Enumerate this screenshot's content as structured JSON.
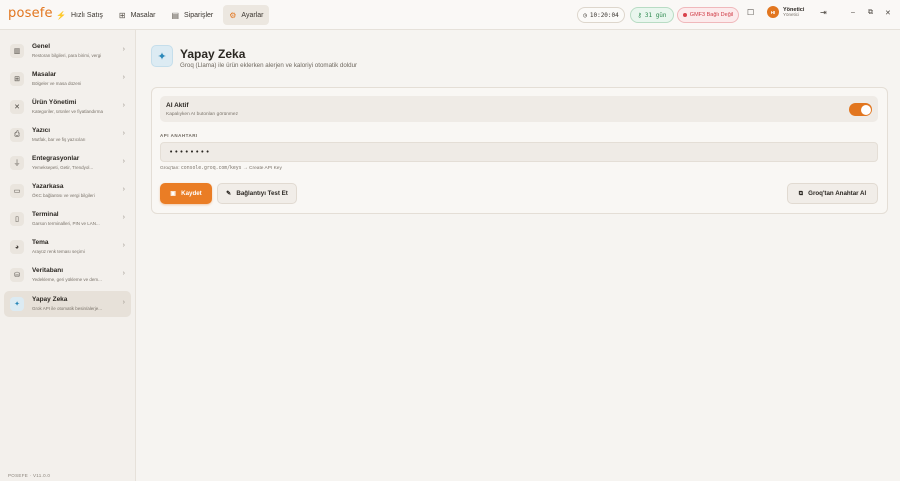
{
  "app": {
    "logo": "posefe",
    "version": "POSEFE · V11.0.0"
  },
  "topbar": {
    "nav": [
      {
        "label": "Hızlı Satış",
        "icon": "bolt-icon"
      },
      {
        "label": "Masalar",
        "icon": "grid-icon"
      },
      {
        "label": "Siparişler",
        "icon": "clipboard-icon"
      },
      {
        "label": "Ayarlar",
        "icon": "gear-icon"
      }
    ],
    "clock": "10:20:04",
    "days": "31 gün",
    "gmf_status": "GMF3 Bağlı Değil",
    "user": {
      "initials": "HI",
      "name": "Yönetici",
      "role": "Yönetici"
    }
  },
  "sidebar": {
    "items": [
      {
        "title": "Genel",
        "subtitle": "Restoran bilgileri, para birimi, vergi",
        "icon": "building-icon"
      },
      {
        "title": "Masalar",
        "subtitle": "Bölgeler ve masa düzeni",
        "icon": "grid-icon"
      },
      {
        "title": "Ürün Yönetimi",
        "subtitle": "Kategoriler, ürünler ve fiyatlandırma",
        "icon": "utensils-icon"
      },
      {
        "title": "Yazıcı",
        "subtitle": "Mutfak, bar ve fiş yazıcıları",
        "icon": "printer-icon"
      },
      {
        "title": "Entegrasyonlar",
        "subtitle": "Yemeksepeti, Getir, Trendyol...",
        "icon": "plug-icon"
      },
      {
        "title": "Yazarkasa",
        "subtitle": "ÖKC bağlantısı ve vergi bilgileri",
        "icon": "card-icon"
      },
      {
        "title": "Terminal",
        "subtitle": "Garson terminalleri, PIN ve LAN...",
        "icon": "tablet-icon"
      },
      {
        "title": "Tema",
        "subtitle": "Arayüz renk teması seçimi",
        "icon": "palette-icon"
      },
      {
        "title": "Veritabanı",
        "subtitle": "Yedekleme, geri yükleme ve dem...",
        "icon": "database-icon"
      },
      {
        "title": "Yapay Zeka",
        "subtitle": "Grok API ile otomatik besin/alerje...",
        "icon": "sparkle-icon"
      }
    ]
  },
  "main": {
    "title": "Yapay Zeka",
    "subtitle": "Groq (Llama) ile ürün eklerken alerjen ve kaloriyi otomatik doldur",
    "ai_toggle": {
      "title": "AI Aktif",
      "subtitle": "Kapalıyken AI butonları görünmez",
      "on": true
    },
    "api_key": {
      "label": "API ANAHTARI",
      "value": "••••••••",
      "hint_prefix": "Groq'tan: ",
      "hint_url": "console.groq.com/keys",
      "hint_suffix": " → Create API Key"
    },
    "buttons": {
      "save": "Kaydet",
      "test": "Bağlantıyı Test Et",
      "get_key": "Groq'tan Anahtar Al"
    }
  }
}
